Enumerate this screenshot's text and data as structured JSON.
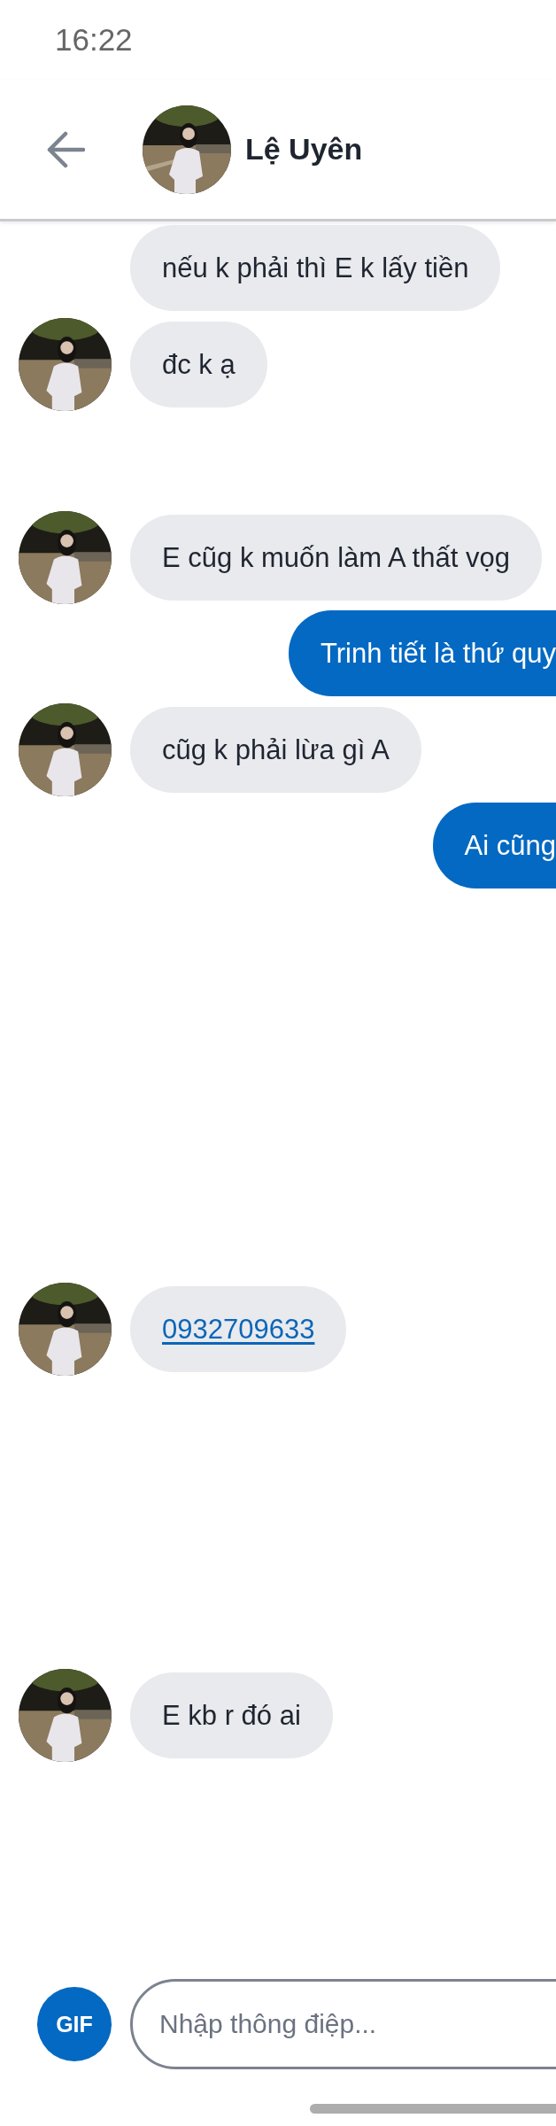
{
  "status_bar": {
    "time": "16:22"
  },
  "header": {
    "contact_name": "Lệ Uyên"
  },
  "messages": [
    {
      "kind": "received",
      "avatar": false,
      "text": "nếu k phải thì E k lấy tiền"
    },
    {
      "kind": "received",
      "avatar": true,
      "text": "đc k ạ"
    },
    {
      "kind": "received",
      "avatar": true,
      "text": "E cũg k muốn làm A thất vọg"
    },
    {
      "kind": "sent",
      "text": "Trinh tiết là thứ quy"
    },
    {
      "kind": "received",
      "avatar": true,
      "text": "cũg k phải lừa gì A"
    },
    {
      "kind": "sent",
      "text": "Ai cũng"
    },
    {
      "kind": "link",
      "avatar": true,
      "text": "0932709633"
    },
    {
      "kind": "received",
      "avatar": true,
      "text": "E kb r đó ai"
    }
  ],
  "composer": {
    "gif_button": "GIF",
    "placeholder": "Nhập thông điệp..."
  }
}
